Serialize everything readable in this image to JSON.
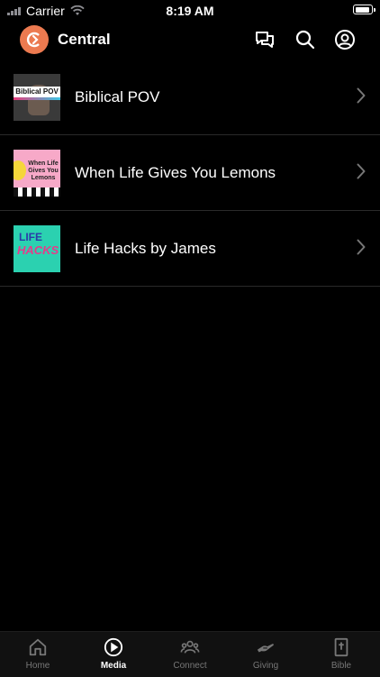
{
  "status_bar": {
    "carrier": "Carrier",
    "time": "8:19 AM"
  },
  "header": {
    "title": "Central"
  },
  "media_items": [
    {
      "title": "Biblical POV",
      "thumb_text": "Biblical POV"
    },
    {
      "title": "When Life Gives You Lemons",
      "thumb_text": "When Life Gives You Lemons"
    },
    {
      "title": "Life Hacks by James",
      "thumb_text_1": "LIFE",
      "thumb_text_2": "HACKS"
    }
  ],
  "tabs": [
    {
      "label": "Home",
      "icon": "home-icon"
    },
    {
      "label": "Media",
      "icon": "play-icon",
      "active": true
    },
    {
      "label": "Connect",
      "icon": "people-icon"
    },
    {
      "label": "Giving",
      "icon": "giving-hand-icon"
    },
    {
      "label": "Bible",
      "icon": "bible-icon"
    }
  ],
  "colors": {
    "accent": "#ec7a50",
    "background": "#000000"
  }
}
